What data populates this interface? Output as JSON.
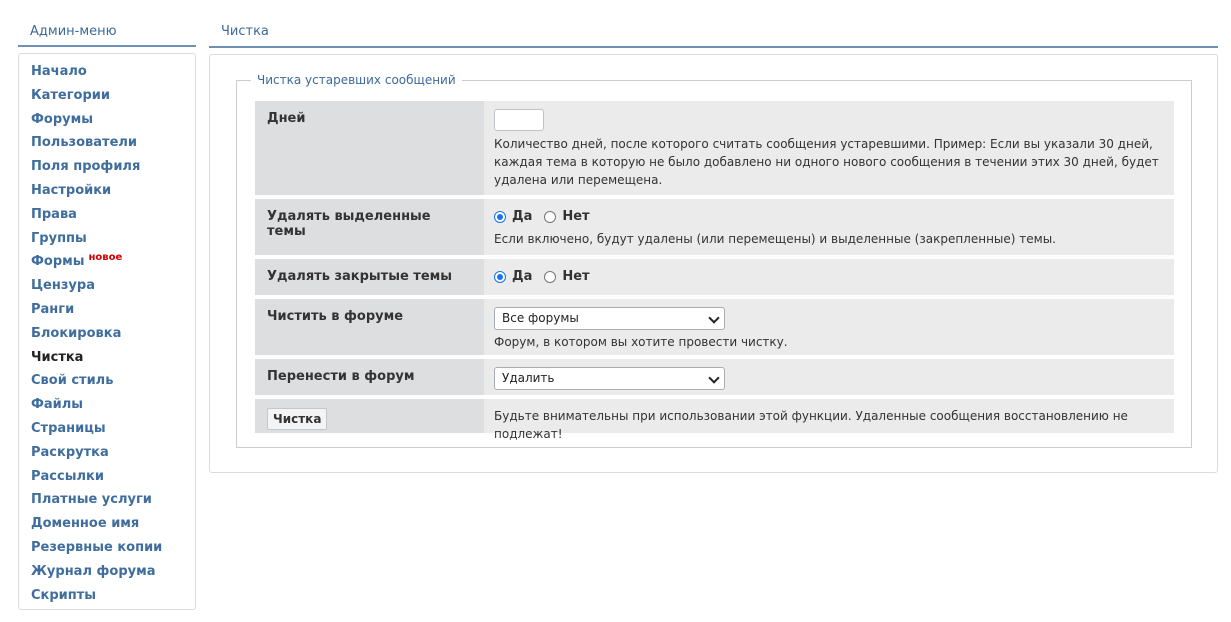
{
  "sidebar": {
    "title": "Админ-меню",
    "items": [
      {
        "label": "Начало"
      },
      {
        "label": "Категории"
      },
      {
        "label": "Форумы"
      },
      {
        "label": "Пользователи"
      },
      {
        "label": "Поля профиля"
      },
      {
        "label": "Настройки"
      },
      {
        "label": "Права"
      },
      {
        "label": "Группы"
      },
      {
        "label": "Формы",
        "badge": "новое"
      },
      {
        "label": "Цензура"
      },
      {
        "label": "Ранги"
      },
      {
        "label": "Блокировка"
      },
      {
        "label": "Чистка",
        "active": true
      },
      {
        "label": "Свой стиль"
      },
      {
        "label": "Файлы"
      },
      {
        "label": "Страницы"
      },
      {
        "label": "Раскрутка"
      },
      {
        "label": "Рассылки"
      },
      {
        "label": "Платные услуги"
      },
      {
        "label": "Доменное имя"
      },
      {
        "label": "Резервные копии"
      },
      {
        "label": "Журнал форума"
      },
      {
        "label": "Скрипты"
      }
    ]
  },
  "main": {
    "title": "Чистка",
    "fieldset_legend": "Чистка устаревших сообщений",
    "days": {
      "label": "Дней",
      "value": "",
      "help": "Количество дней, после которого считать сообщения устаревшими. Пример: Если вы указали 30 дней, каждая тема в которую не было добавлено ни одного нового сообщения в течении этих 30 дней, будет удалена или перемещена."
    },
    "delete_sticky": {
      "label": "Удалять выделенные темы",
      "yes": "Да",
      "no": "Нет",
      "selected": "yes",
      "help": "Если включено, будут удалены (или перемещены) и выделенные (закрепленные) темы."
    },
    "delete_closed": {
      "label": "Удалять закрытые темы",
      "yes": "Да",
      "no": "Нет",
      "selected": "yes"
    },
    "forum": {
      "label": "Чистить в форуме",
      "selected": "Все форумы",
      "help": "Форум, в котором вы хотите провести чистку."
    },
    "move_to": {
      "label": "Перенести в форум",
      "selected": "Удалить"
    },
    "submit": {
      "label": "Чистка",
      "warning": "Будьте внимательны при использовании этой функции. Удаленные сообщения восстановлению не подлежат!"
    }
  },
  "colors": {
    "link": "#3f6d9d",
    "accent_line": "#6f90b3",
    "label_bg": "#dcdee0",
    "value_bg": "#ebebeb",
    "badge": "#d10000"
  }
}
